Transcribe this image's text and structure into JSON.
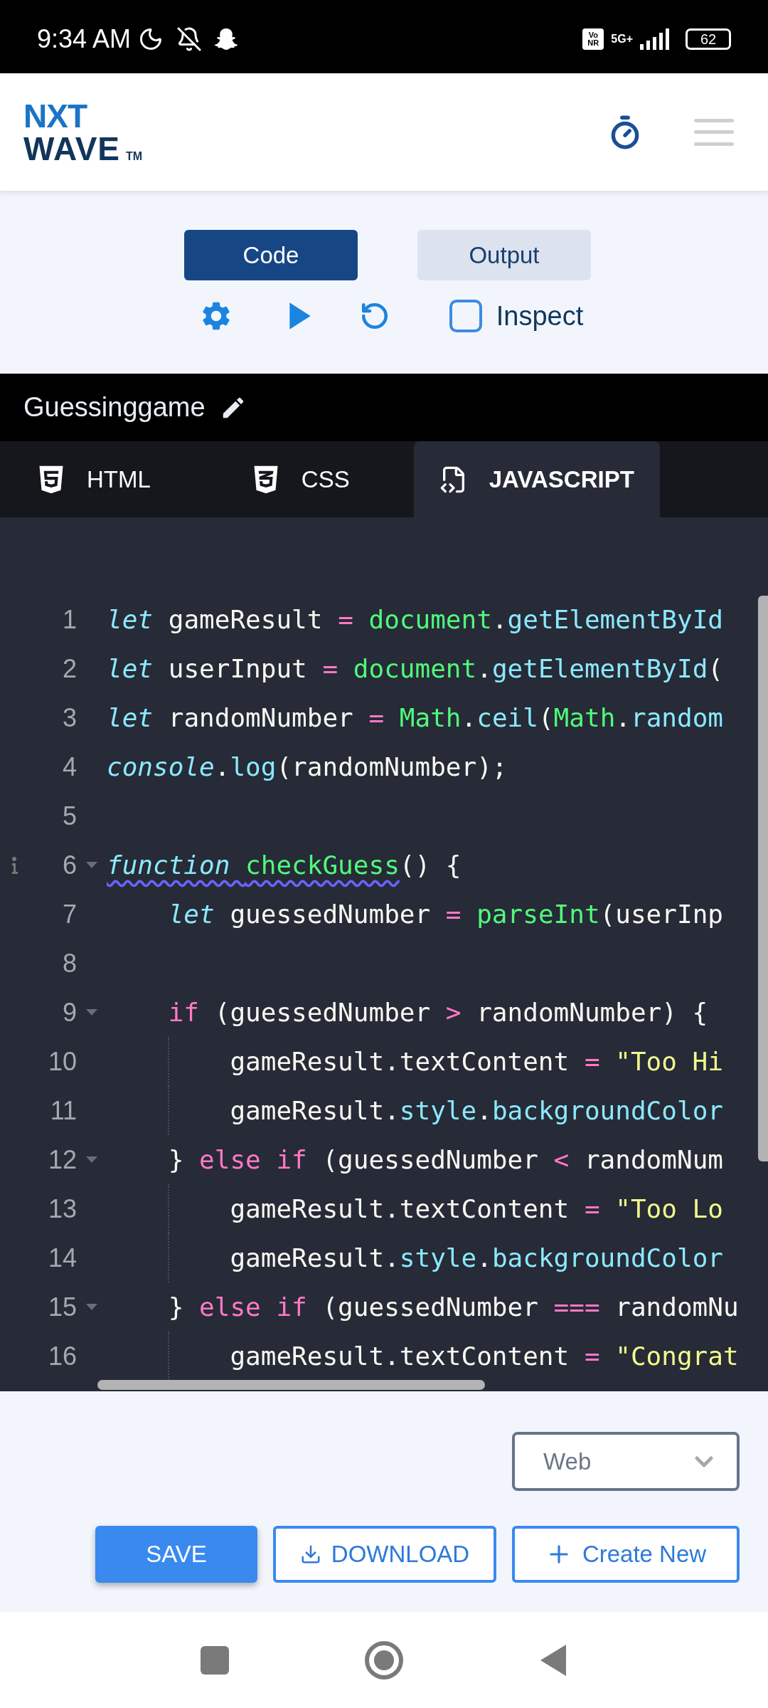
{
  "status_bar": {
    "time": "9:34 AM",
    "volte": "Vo NR",
    "network": "5G+",
    "battery": "62"
  },
  "header": {
    "logo_top": "NXT",
    "logo_bottom": "WAVE",
    "logo_mark": "TM"
  },
  "view_toggle": [
    {
      "label": "Code",
      "selected": true
    },
    {
      "label": "Output",
      "selected": false
    }
  ],
  "toolbar": {
    "inspect": {
      "label": "Inspect",
      "checked": false
    }
  },
  "project": {
    "title": "Guessinggame"
  },
  "file_tabs": [
    {
      "label": "HTML",
      "kind": "html",
      "selected": false
    },
    {
      "label": "CSS",
      "kind": "css",
      "selected": false
    },
    {
      "label": "JAVASCRIPT",
      "kind": "js",
      "selected": true
    }
  ],
  "editor": {
    "lines": [
      {
        "number": "1",
        "foldable": false,
        "annotation": false,
        "tokens": [
          {
            "text": "let",
            "kind": "storage"
          },
          {
            "text": " gameResult ",
            "kind": "plain"
          },
          {
            "text": "=",
            "kind": "operator"
          },
          {
            "text": " document",
            "kind": "entity"
          },
          {
            "text": ".",
            "kind": "plain"
          },
          {
            "text": "getElementById",
            "kind": "support"
          }
        ]
      },
      {
        "number": "2",
        "foldable": false,
        "annotation": false,
        "tokens": [
          {
            "text": "let",
            "kind": "storage"
          },
          {
            "text": " userInput ",
            "kind": "plain"
          },
          {
            "text": "=",
            "kind": "operator"
          },
          {
            "text": " document",
            "kind": "entity"
          },
          {
            "text": ".",
            "kind": "plain"
          },
          {
            "text": "getElementById",
            "kind": "support"
          },
          {
            "text": "(",
            "kind": "plain"
          }
        ]
      },
      {
        "number": "3",
        "foldable": false,
        "annotation": false,
        "tokens": [
          {
            "text": "let",
            "kind": "storage"
          },
          {
            "text": " randomNumber ",
            "kind": "plain"
          },
          {
            "text": "=",
            "kind": "operator"
          },
          {
            "text": " Math",
            "kind": "entity"
          },
          {
            "text": ".",
            "kind": "plain"
          },
          {
            "text": "ceil",
            "kind": "support"
          },
          {
            "text": "(",
            "kind": "plain"
          },
          {
            "text": "Math",
            "kind": "entity"
          },
          {
            "text": ".",
            "kind": "plain"
          },
          {
            "text": "random",
            "kind": "support"
          }
        ]
      },
      {
        "number": "4",
        "foldable": false,
        "annotation": false,
        "tokens": [
          {
            "text": "console",
            "kind": "storage"
          },
          {
            "text": ".",
            "kind": "plain"
          },
          {
            "text": "log",
            "kind": "support"
          },
          {
            "text": "(randomNumber);",
            "kind": "plain"
          }
        ]
      },
      {
        "number": "5",
        "foldable": false,
        "annotation": false
      },
      {
        "number": "6",
        "foldable": true,
        "annotation": true,
        "tokens": [
          {
            "text": "function ",
            "kind": "storage",
            "squiggle": true
          },
          {
            "text": "checkGuess",
            "kind": "entity",
            "squiggle": true
          },
          {
            "text": "() {",
            "kind": "plain"
          }
        ]
      },
      {
        "number": "7",
        "foldable": false,
        "annotation": false,
        "tokens": [
          {
            "text": "    let",
            "kind": "storage"
          },
          {
            "text": " guessedNumber ",
            "kind": "plain"
          },
          {
            "text": "=",
            "kind": "operator"
          },
          {
            "text": " parseInt",
            "kind": "entity"
          },
          {
            "text": "(userInp",
            "kind": "plain"
          }
        ]
      },
      {
        "number": "8",
        "foldable": false,
        "annotation": false
      },
      {
        "number": "9",
        "foldable": true,
        "annotation": false,
        "tokens": [
          {
            "text": "    if",
            "kind": "keyword"
          },
          {
            "text": " (guessedNumber ",
            "kind": "plain"
          },
          {
            "text": ">",
            "kind": "operator"
          },
          {
            "text": " randomNumber) {",
            "kind": "plain"
          }
        ]
      },
      {
        "number": "10",
        "foldable": false,
        "annotation": false,
        "tokens": [
          {
            "text": "        gameResult.textContent ",
            "kind": "plain"
          },
          {
            "text": "=",
            "kind": "operator"
          },
          {
            "text": " \"Too Hi",
            "kind": "string"
          }
        ]
      },
      {
        "number": "11",
        "foldable": false,
        "annotation": false,
        "tokens": [
          {
            "text": "        gameResult.",
            "kind": "plain"
          },
          {
            "text": "style",
            "kind": "support"
          },
          {
            "text": ".",
            "kind": "plain"
          },
          {
            "text": "backgroundColor",
            "kind": "support"
          }
        ]
      },
      {
        "number": "12",
        "foldable": true,
        "annotation": false,
        "tokens": [
          {
            "text": "    } ",
            "kind": "plain"
          },
          {
            "text": "else if",
            "kind": "keyword"
          },
          {
            "text": " (guessedNumber ",
            "kind": "plain"
          },
          {
            "text": "<",
            "kind": "operator"
          },
          {
            "text": " randomNum",
            "kind": "plain"
          }
        ]
      },
      {
        "number": "13",
        "foldable": false,
        "annotation": false,
        "tokens": [
          {
            "text": "        gameResult.textContent ",
            "kind": "plain"
          },
          {
            "text": "=",
            "kind": "operator"
          },
          {
            "text": " \"Too Lo",
            "kind": "string"
          }
        ]
      },
      {
        "number": "14",
        "foldable": false,
        "annotation": false,
        "tokens": [
          {
            "text": "        gameResult.",
            "kind": "plain"
          },
          {
            "text": "style",
            "kind": "support"
          },
          {
            "text": ".",
            "kind": "plain"
          },
          {
            "text": "backgroundColor",
            "kind": "support"
          }
        ]
      },
      {
        "number": "15",
        "foldable": true,
        "annotation": false,
        "tokens": [
          {
            "text": "    } ",
            "kind": "plain"
          },
          {
            "text": "else if",
            "kind": "keyword"
          },
          {
            "text": " (guessedNumber ",
            "kind": "plain"
          },
          {
            "text": "===",
            "kind": "operator"
          },
          {
            "text": " randomNu",
            "kind": "plain"
          }
        ]
      },
      {
        "number": "16",
        "foldable": false,
        "annotation": false,
        "tokens": [
          {
            "text": "        gameResult.textContent ",
            "kind": "plain"
          },
          {
            "text": "=",
            "kind": "operator"
          },
          {
            "text": " \"Congrat",
            "kind": "string"
          }
        ]
      }
    ]
  },
  "mode_select": {
    "value": "Web"
  },
  "actions": [
    {
      "label": "SAVE",
      "kind": "primary"
    },
    {
      "label": "DOWNLOAD",
      "kind": "download"
    },
    {
      "label": "Create New",
      "kind": "create"
    }
  ]
}
